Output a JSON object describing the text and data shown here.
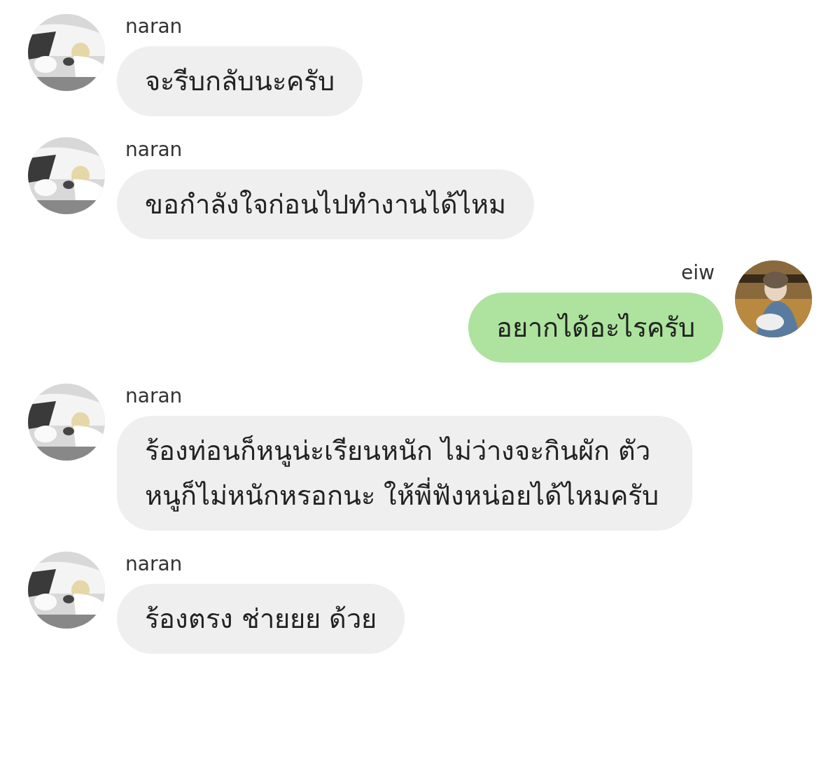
{
  "messages": [
    {
      "kind": "received",
      "sender": "naran",
      "text": "จะรีบกลับนะครับ"
    },
    {
      "kind": "received",
      "sender": "naran",
      "text": "ขอกำลังใจก่อนไปทำงานได้ไหม"
    },
    {
      "kind": "sent",
      "sender": "eiw",
      "text": "อยากได้อะไรครับ"
    },
    {
      "kind": "received",
      "sender": "naran",
      "text": "ร้องท่อนก็หนูน่ะเรียนหนัก ไม่ว่างจะกินผัก ตัวหนูก็ไม่หนักหรอกนะ ให้พี่ฟังหน่อยได้ไหมครับ"
    },
    {
      "kind": "received",
      "sender": "naran",
      "text": "ร้องตรง ช่ายยย ด้วย"
    }
  ]
}
